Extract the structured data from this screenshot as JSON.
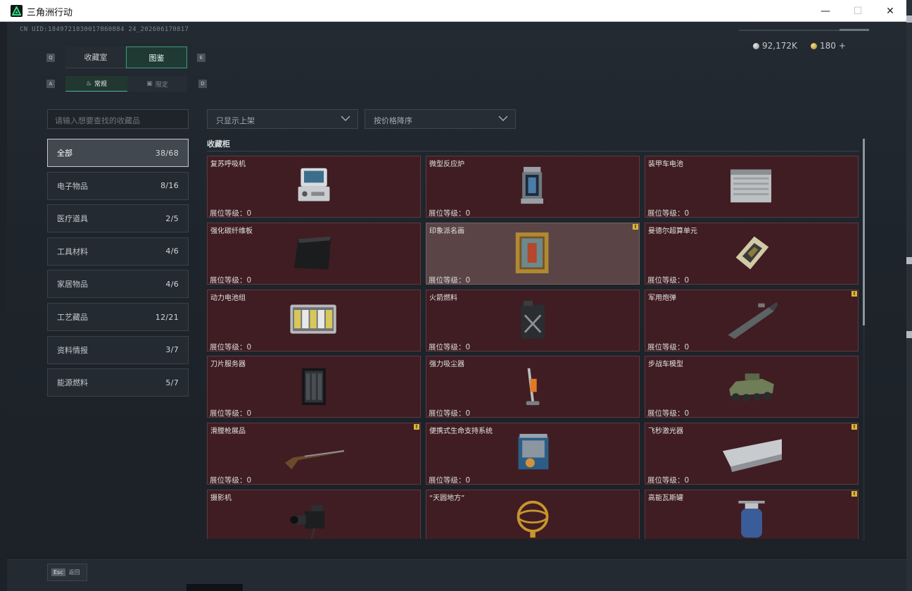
{
  "window": {
    "title": "三角洲行动",
    "min": "—",
    "max": "☐",
    "close": "✕"
  },
  "uid": "CN UID:1849721830017860884 24_202606170817",
  "currency": {
    "silver": "92,172K",
    "gold": "180",
    "add": "+"
  },
  "keys": {
    "prev_tab": "Q",
    "next_tab": "E",
    "prev_sub": "A",
    "next_sub": "D"
  },
  "tabs": [
    {
      "label": "收藏室"
    },
    {
      "label": "图鉴"
    }
  ],
  "subtabs": [
    {
      "label": "常规",
      "icon": "flame-icon"
    },
    {
      "label": "限定",
      "icon": "limited-icon"
    }
  ],
  "search": {
    "placeholder": "请输入想要查找的收藏品"
  },
  "categories": [
    {
      "label": "全部",
      "count": "38/68"
    },
    {
      "label": "电子物品",
      "count": "8/16"
    },
    {
      "label": "医疗道具",
      "count": "2/5"
    },
    {
      "label": "工具材料",
      "count": "4/6"
    },
    {
      "label": "家居物品",
      "count": "4/6"
    },
    {
      "label": "工艺藏品",
      "count": "12/21"
    },
    {
      "label": "资料情报",
      "count": "3/7"
    },
    {
      "label": "能源燃料",
      "count": "5/7"
    }
  ],
  "filters": {
    "shelf": "只显示上架",
    "sort": "按价格降序"
  },
  "section_title": "收藏柜",
  "items": [
    {
      "name": "复苏呼吸机",
      "level": "展位等级：0",
      "warn": false,
      "icon": "ventilator-icon"
    },
    {
      "name": "微型反应炉",
      "level": "展位等级：0",
      "warn": false,
      "icon": "reactor-icon"
    },
    {
      "name": "装甲车电池",
      "level": "展位等级：0",
      "warn": false,
      "icon": "battery-icon"
    },
    {
      "name": "强化碳纤维板",
      "level": "展位等级：0",
      "warn": false,
      "icon": "carbon-plate-icon"
    },
    {
      "name": "印象派名画",
      "level": "展位等级：0",
      "warn": true,
      "icon": "painting-icon"
    },
    {
      "name": "曼德尔超算单元",
      "level": "展位等级：0",
      "warn": false,
      "icon": "chip-icon"
    },
    {
      "name": "动力电池组",
      "level": "展位等级：0",
      "warn": false,
      "icon": "battery-pack-icon"
    },
    {
      "name": "火箭燃料",
      "level": "展位等级：0",
      "warn": false,
      "icon": "fuel-can-icon"
    },
    {
      "name": "军用炮弹",
      "level": "展位等级：0",
      "warn": true,
      "icon": "shell-icon"
    },
    {
      "name": "刀片服务器",
      "level": "展位等级：0",
      "warn": false,
      "icon": "server-icon"
    },
    {
      "name": "强力吸尘器",
      "level": "展位等级：0",
      "warn": false,
      "icon": "vacuum-icon"
    },
    {
      "name": "步战车模型",
      "level": "展位等级：0",
      "warn": false,
      "icon": "vehicle-icon"
    },
    {
      "name": "滑膛枪展品",
      "level": "展位等级：0",
      "warn": true,
      "icon": "musket-icon"
    },
    {
      "name": "便携式生命支持系统",
      "level": "展位等级：0",
      "warn": false,
      "icon": "life-support-icon"
    },
    {
      "name": "飞秒激光器",
      "level": "展位等级：0",
      "warn": true,
      "icon": "laser-icon"
    },
    {
      "name": "摄影机",
      "level": "展位等级：0",
      "warn": false,
      "icon": "camera-icon"
    },
    {
      "name": "“天圆地方”",
      "level": "展位等级：0",
      "warn": false,
      "icon": "armillary-icon"
    },
    {
      "name": "高能瓦斯罐",
      "level": "展位等级：0",
      "warn": true,
      "icon": "gas-can-icon"
    }
  ],
  "bottom": {
    "esc_key": "Esc",
    "esc_label": "返回"
  }
}
